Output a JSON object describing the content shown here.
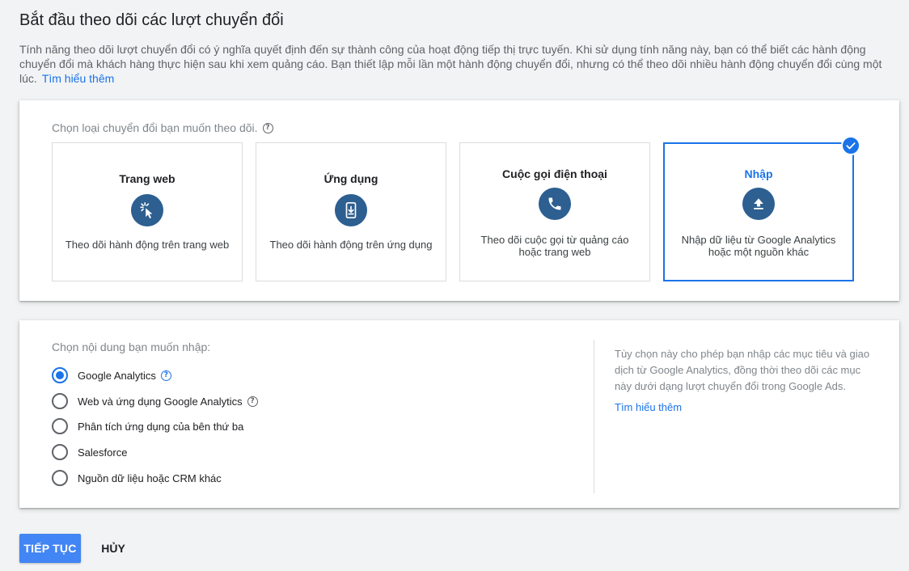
{
  "page": {
    "title": "Bắt đầu theo dõi các lượt chuyển đổi",
    "intro": "Tính năng theo dõi lượt chuyển đổi có ý nghĩa quyết định đến sự thành công của hoạt động tiếp thị trực tuyến. Khi sử dụng tính năng này, bạn có thể biết các hành động chuyển đổi mà khách hàng thực hiện sau khi xem quảng cáo. Bạn thiết lập mỗi lần một hành động chuyển đổi, nhưng có thể theo dõi nhiều hành động chuyển đổi cùng một lúc.",
    "intro_link": "Tìm hiểu thêm"
  },
  "conversion_types": {
    "label": "Chọn loại chuyển đổi bạn muốn theo dõi.",
    "options": [
      {
        "title": "Trang web",
        "desc": "Theo dõi hành động trên trang web",
        "icon": "cursor-click-icon",
        "selected": false
      },
      {
        "title": "Ứng dụng",
        "desc": "Theo dõi hành động trên ứng dụng",
        "icon": "phone-download-icon",
        "selected": false
      },
      {
        "title": "Cuộc gọi điện thoại",
        "desc": "Theo dõi cuộc gọi từ quảng cáo hoặc trang web",
        "icon": "phone-icon",
        "selected": false
      },
      {
        "title": "Nhập",
        "desc": "Nhập dữ liệu từ Google Analytics hoặc một nguồn khác",
        "icon": "upload-icon",
        "selected": true
      }
    ]
  },
  "import_source": {
    "label": "Chọn nội dung bạn muốn nhập:",
    "options": [
      {
        "label": "Google Analytics",
        "checked": true,
        "help": true
      },
      {
        "label": "Web và ứng dụng Google Analytics",
        "checked": false,
        "help": true
      },
      {
        "label": "Phân tích ứng dụng của bên thứ ba",
        "checked": false,
        "help": false
      },
      {
        "label": "Salesforce",
        "checked": false,
        "help": false
      },
      {
        "label": "Nguồn dữ liệu hoặc CRM khác",
        "checked": false,
        "help": false
      }
    ],
    "info": "Tùy chọn này cho phép bạn nhập các mục tiêu và giao dịch từ Google Analytics, đồng thời theo dõi các mục này dưới dạng lượt chuyển đổi trong Google Ads.",
    "info_link": "Tìm hiểu thêm"
  },
  "actions": {
    "continue_label": "TIẾP TỤC",
    "cancel_label": "HỦY"
  },
  "colors": {
    "accent": "#1a73e8",
    "icon_bg": "#2d5f91",
    "primary_button": "#4285f4"
  }
}
